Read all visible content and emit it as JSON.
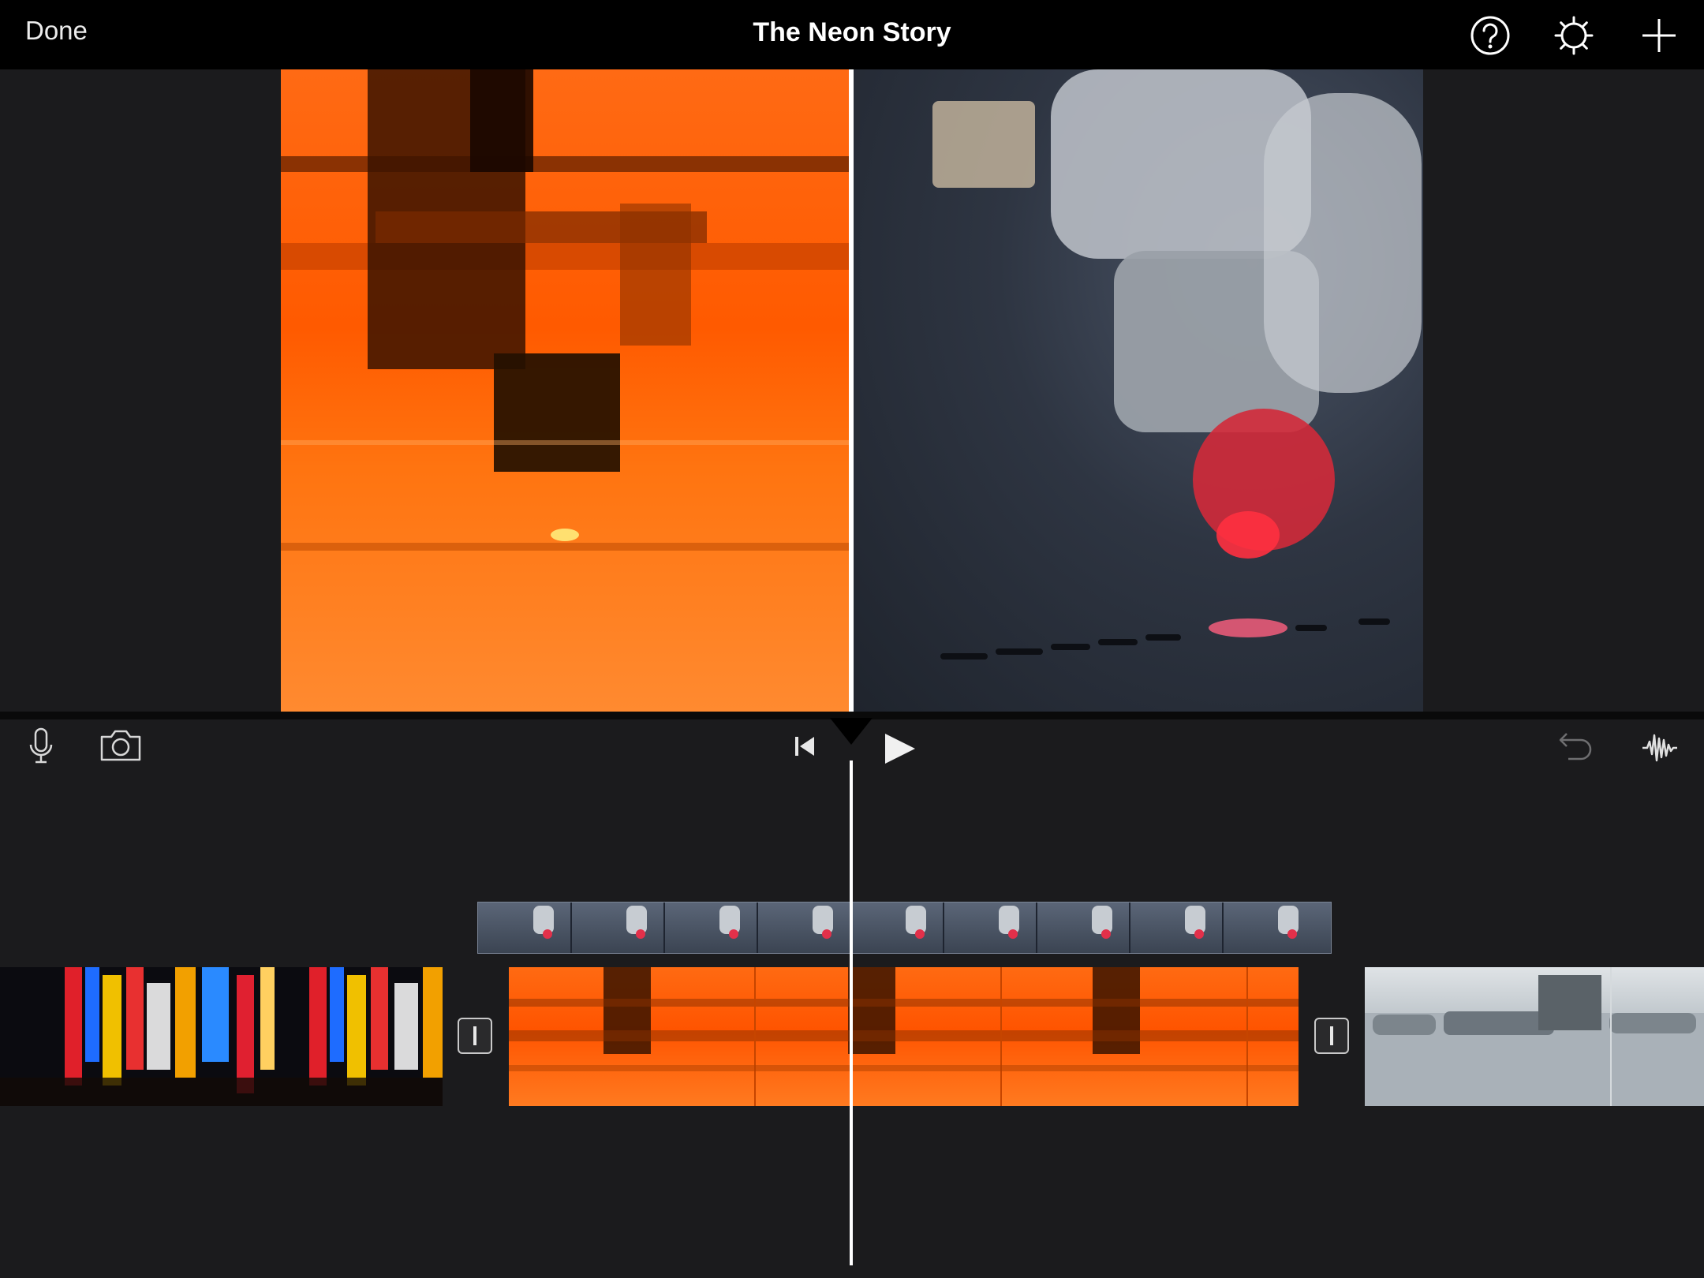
{
  "header": {
    "done_label": "Done",
    "title": "The Neon Story",
    "icons": [
      "help-icon",
      "settings-icon",
      "add-icon"
    ]
  },
  "viewer": {
    "clips": [
      "orange-laser-cutter-video",
      "laser-head-closeup-video"
    ]
  },
  "controls": {
    "left_icons": [
      "microphone-icon",
      "camera-icon"
    ],
    "center_icons": [
      "skip-to-start-icon",
      "play-icon"
    ],
    "right_icons": [
      "undo-icon",
      "audio-waveform-icon"
    ]
  },
  "timeline": {
    "clips": [
      "neon-signs-clip",
      "orange-laser-clip",
      "metal-vat-clip"
    ],
    "overlay_clip": "laser-closeup-overlay-clip",
    "transitions": 2
  },
  "colors": {
    "accent_orange": "#ff5a00",
    "background": "#1b1b1d",
    "topbar": "#000000"
  }
}
